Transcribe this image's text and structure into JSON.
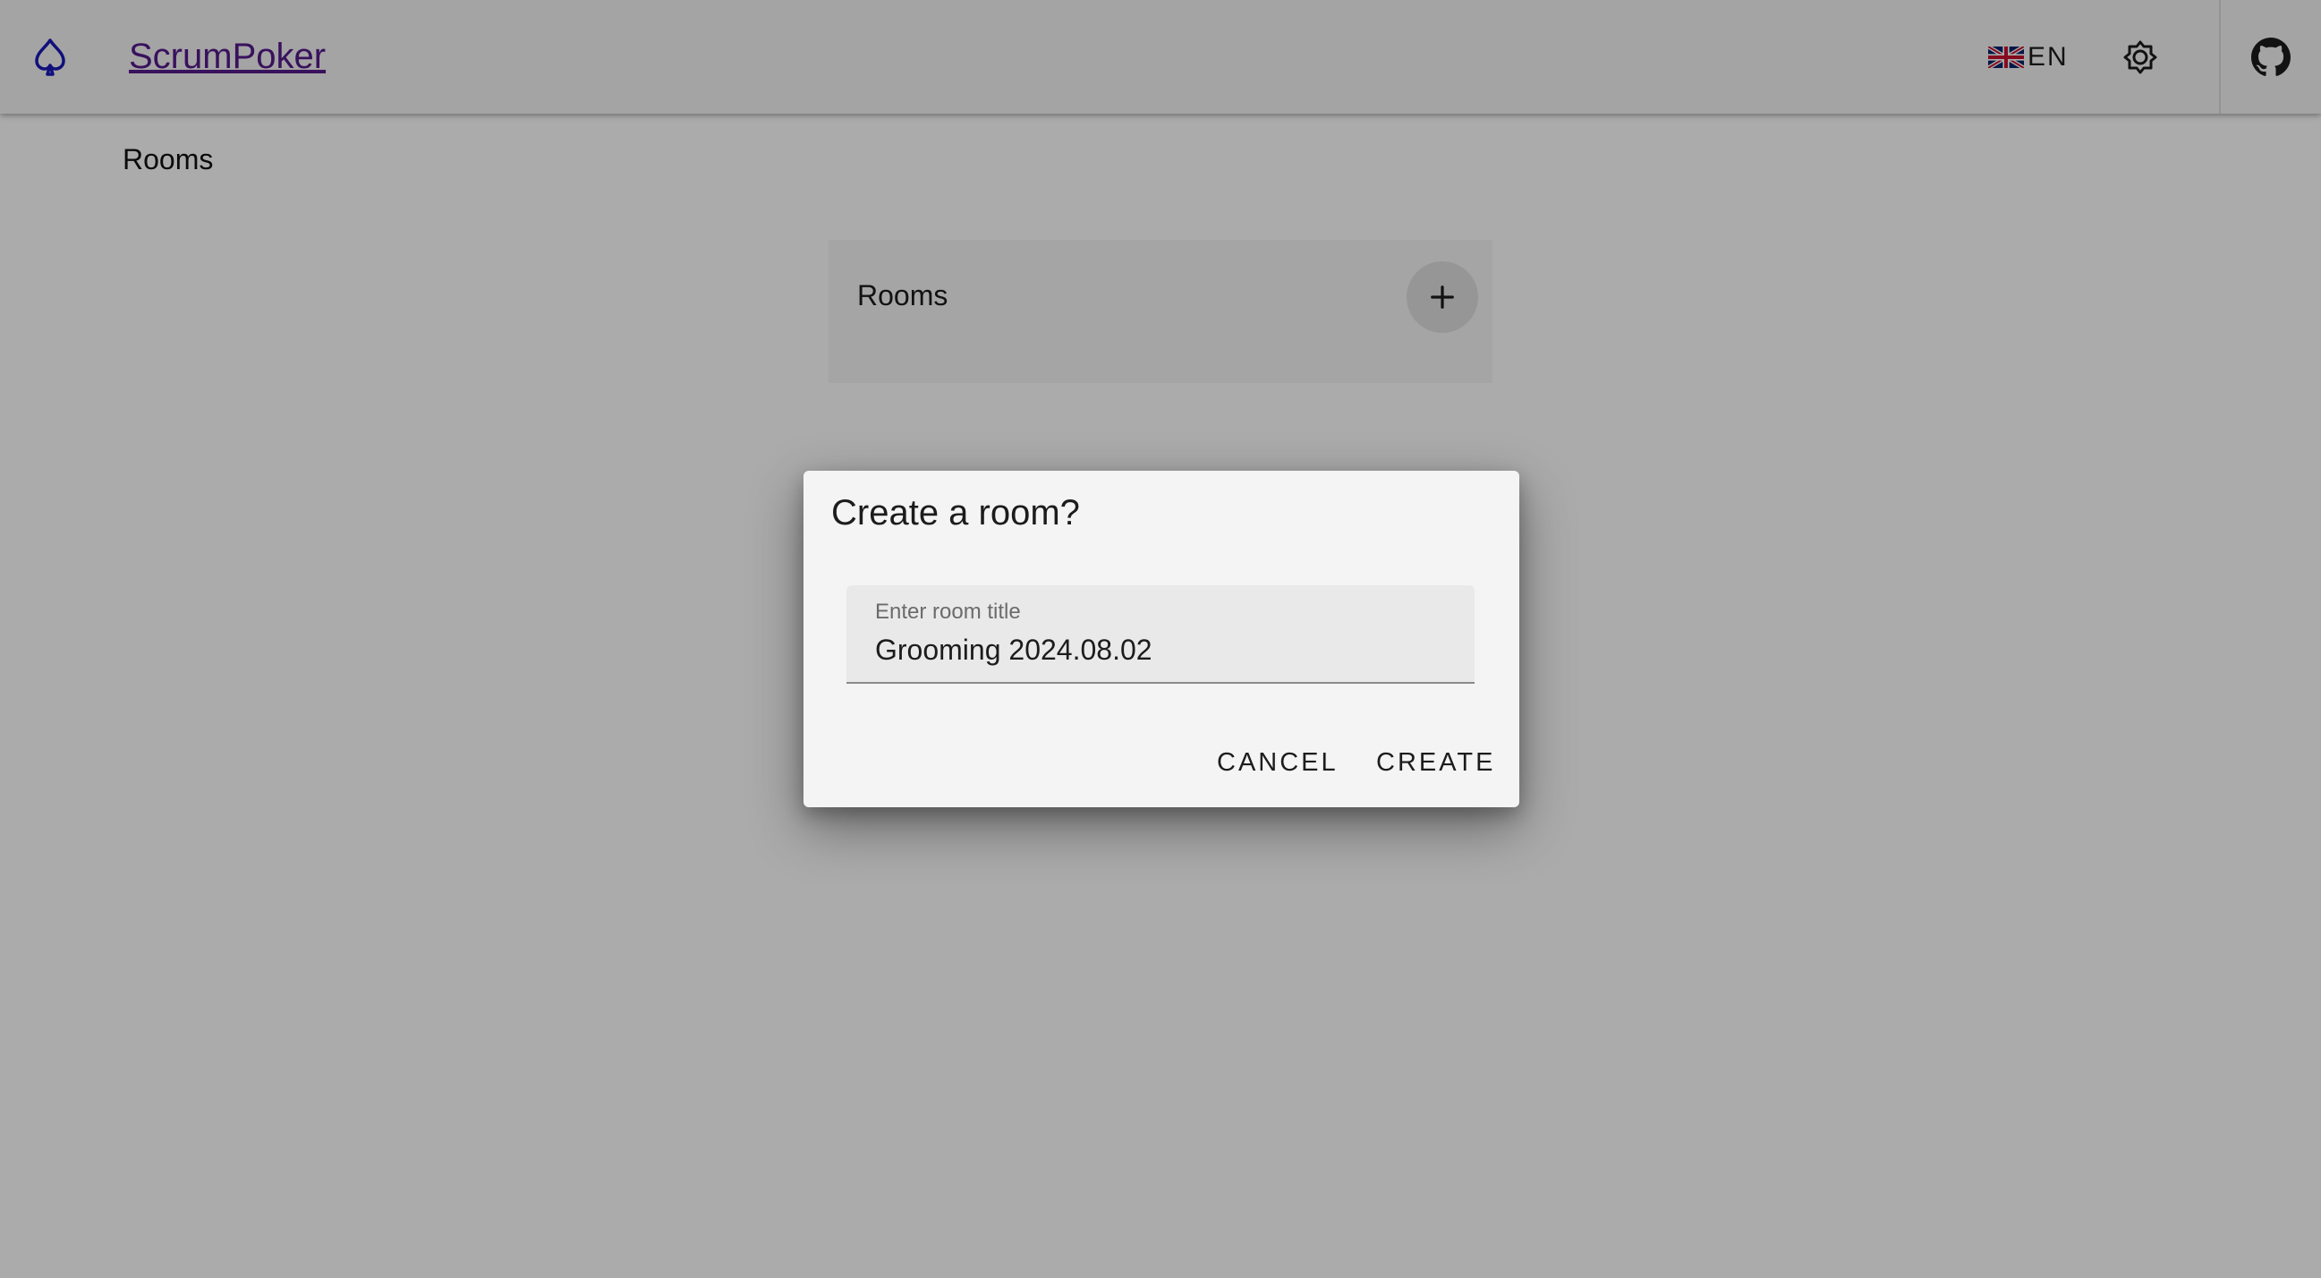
{
  "header": {
    "app_name": "ScrumPoker",
    "logo_icon": "spade-icon",
    "language_code": "EN",
    "language_flag": "uk-flag-icon",
    "theme_icon": "brightness-icon",
    "github_icon": "github-icon",
    "accent_color": "#1a18b8"
  },
  "breadcrumb": {
    "label": "Rooms"
  },
  "rooms_panel": {
    "title": "Rooms",
    "add_icon": "plus-icon"
  },
  "dialog": {
    "title": "Create a room?",
    "field_label": "Enter room title",
    "field_value": "Grooming 2024.08.02",
    "cancel_label": "CANCEL",
    "create_label": "CREATE"
  }
}
